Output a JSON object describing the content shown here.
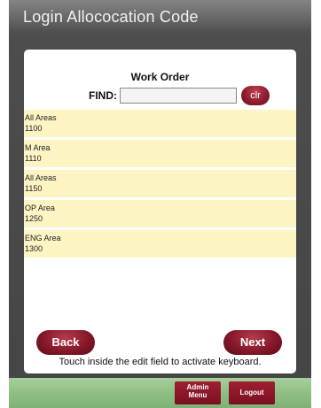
{
  "window": {
    "title": "Login Allococation Code"
  },
  "panel": {
    "title": "Work Order",
    "find_label": "FIND:",
    "find_value": "",
    "clr_label": "clr",
    "items": [
      {
        "name": "All Areas",
        "code": "1100"
      },
      {
        "name": "M Area",
        "code": "1110"
      },
      {
        "name": "All Areas",
        "code": "1150"
      },
      {
        "name": "OP Area",
        "code": "1250"
      },
      {
        "name": "ENG Area",
        "code": "1300"
      }
    ],
    "back_label": "Back",
    "next_label": "Next",
    "hint": "Touch inside the edit field to activate keyboard."
  },
  "bottom_bar": {
    "admin_line1": "Admin",
    "admin_line2": "Menu",
    "logout_label": "Logout"
  },
  "colors": {
    "accent": "#8a1a2a",
    "list_bg": "#fdf4c4",
    "bottom_bar": "#8fbf84"
  }
}
